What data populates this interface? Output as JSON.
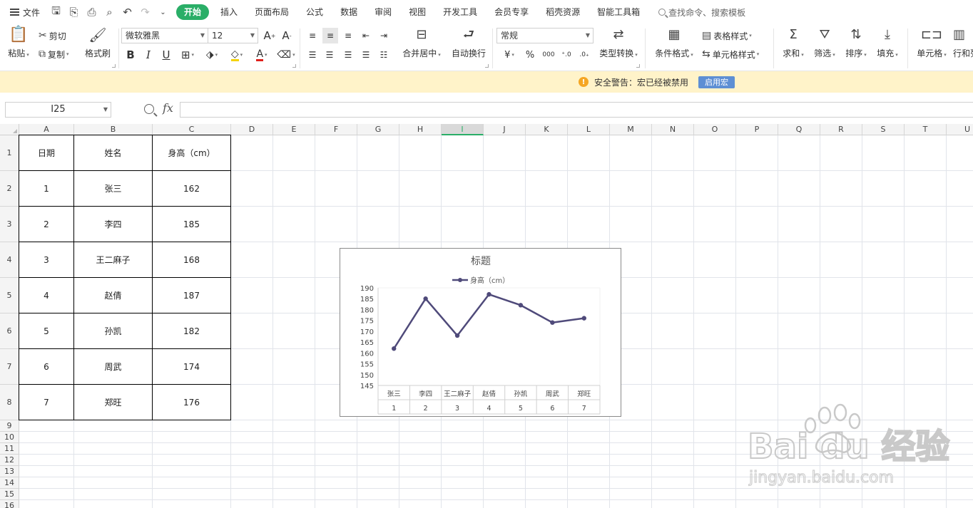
{
  "menu": {
    "file_label": "文件",
    "tabs": [
      "开始",
      "插入",
      "页面布局",
      "公式",
      "数据",
      "审阅",
      "视图",
      "开发工具",
      "会员专享",
      "稻壳资源",
      "智能工具箱"
    ],
    "active_tab_index": 0,
    "search_placeholder": "查找命令、搜索模板"
  },
  "ribbon": {
    "paste": "粘贴",
    "cut": "剪切",
    "copy": "复制",
    "format_painter": "格式刷",
    "font_name": "微软雅黑",
    "font_size": "12",
    "merge_center": "合并居中",
    "wrap_text": "自动换行",
    "number_format": "常规",
    "type_convert": "类型转换",
    "conditional_format": "条件格式",
    "table_style": "表格样式",
    "cell_style": "单元格样式",
    "sum": "求和",
    "filter": "筛选",
    "sort": "排序",
    "fill": "填充",
    "cells": "单元格",
    "rows_cols": "行和列"
  },
  "security": {
    "warning_text": "安全警告：宏已经被禁用",
    "enable_button": "启用宏"
  },
  "formula_bar": {
    "name_box": "I25",
    "fx_label": "fx",
    "formula_value": ""
  },
  "sheet": {
    "columns": [
      "A",
      "B",
      "C",
      "D",
      "E",
      "F",
      "G",
      "H",
      "I",
      "J",
      "K",
      "L",
      "M",
      "N",
      "O",
      "P",
      "Q",
      "R",
      "S",
      "T",
      "U"
    ],
    "selected_column": "I",
    "rows": [
      "1",
      "2",
      "3",
      "4",
      "5",
      "6",
      "7",
      "8",
      "9",
      "10",
      "11",
      "12",
      "13",
      "14",
      "15",
      "16"
    ],
    "table": {
      "headers": [
        "日期",
        "姓名",
        "身高（cm）"
      ],
      "rows": [
        [
          "1",
          "张三",
          "162"
        ],
        [
          "2",
          "李四",
          "185"
        ],
        [
          "3",
          "王二麻子",
          "168"
        ],
        [
          "4",
          "赵倩",
          "187"
        ],
        [
          "5",
          "孙凯",
          "182"
        ],
        [
          "6",
          "周武",
          "174"
        ],
        [
          "7",
          "郑旺",
          "176"
        ]
      ]
    }
  },
  "chart_data": {
    "type": "line",
    "title": "标题",
    "categories": [
      "张三",
      "李四",
      "王二麻子",
      "赵倩",
      "孙凯",
      "周武",
      "郑旺"
    ],
    "category_numbers": [
      "1",
      "2",
      "3",
      "4",
      "5",
      "6",
      "7"
    ],
    "series": [
      {
        "name": "身高（cm）",
        "values": [
          162,
          185,
          168,
          187,
          182,
          174,
          176
        ],
        "color": "#4f4a7a"
      }
    ],
    "ylim": [
      145,
      190
    ],
    "yticks": [
      145,
      150,
      155,
      160,
      165,
      170,
      175,
      180,
      185,
      190
    ],
    "legend_position": "top",
    "grid": false
  },
  "watermark": {
    "brand": "Bai du 经验",
    "url": "jingyan.baidu.com"
  },
  "colors": {
    "accent": "#2aae67",
    "warning_bg": "#fff3c9",
    "macro_button": "#5e8fd4",
    "series": "#4f4a7a"
  }
}
